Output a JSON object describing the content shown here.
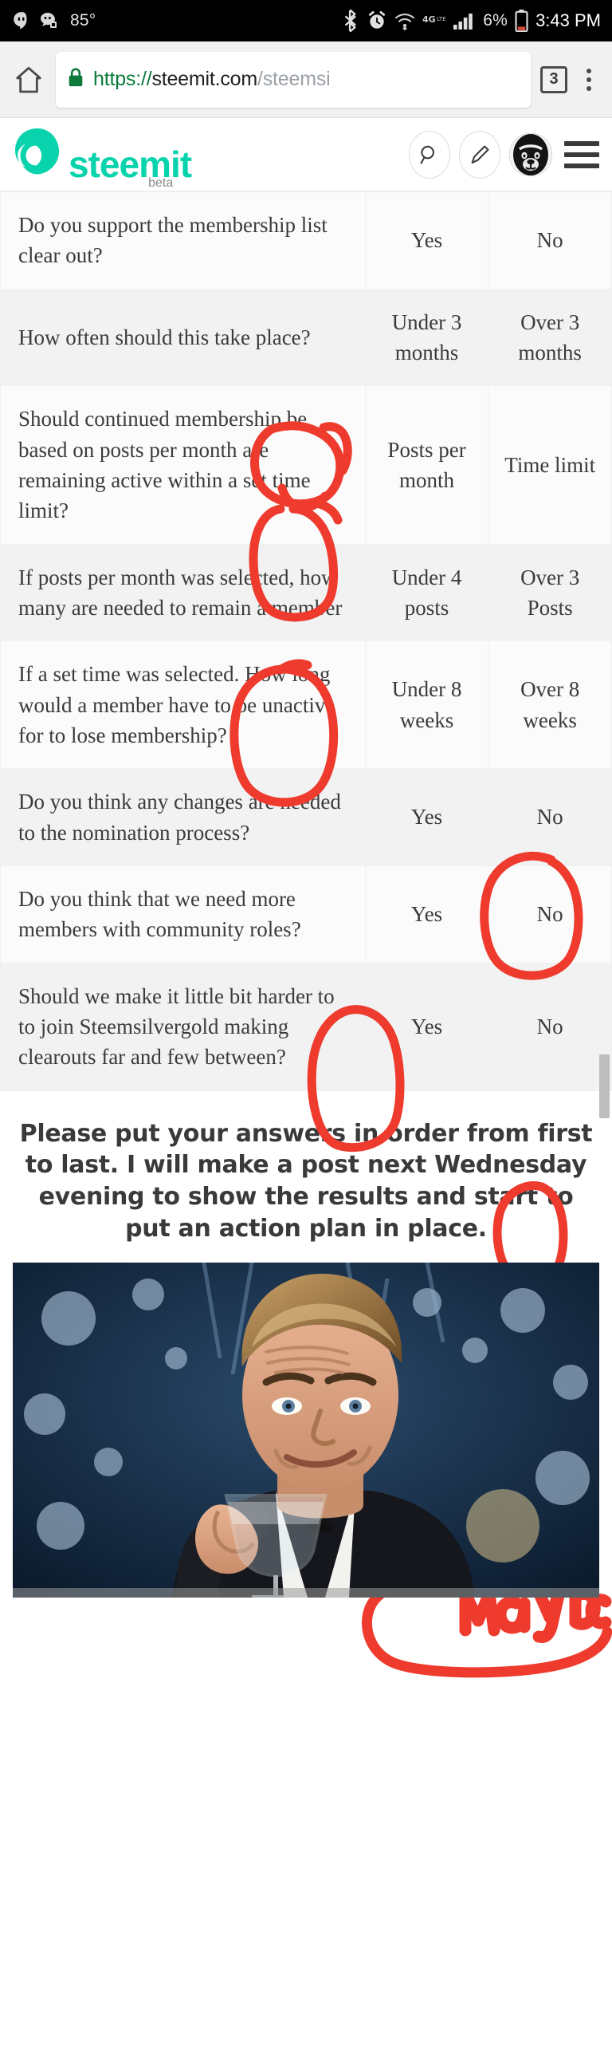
{
  "statusbar": {
    "left_icons": [
      "hangouts-icon",
      "messages-icon"
    ],
    "temperature": "85°",
    "right_icons": [
      "bluetooth-icon",
      "alarm-icon",
      "wifi-icon",
      "lte-icon",
      "signal-icon",
      "battery-icon"
    ],
    "network_label": "4G",
    "battery_percent": "6%",
    "time": "3:43 PM"
  },
  "browser": {
    "home_icon": "home-icon",
    "lock_icon": "lock-icon",
    "url_scheme": "https://",
    "url_host": "steemit.com",
    "url_path": "/steemsi",
    "tab_count": "3",
    "menu_icon": "kebab-menu-icon"
  },
  "site_header": {
    "brand": "steemit",
    "brand_tag": "beta",
    "brand_color": "#09d3ac",
    "search_icon": "search-icon",
    "compose_icon": "pencil-icon",
    "avatar": "user-avatar",
    "menu_icon": "hamburger-icon"
  },
  "survey": {
    "rows": [
      {
        "question": "Do you support the membership list clear out?",
        "option_a": "Yes",
        "option_b": "No",
        "circled": "a"
      },
      {
        "question": "How often should this take place?",
        "option_a": "Under 3 months",
        "option_b": "Over 3 months",
        "circled": "a"
      },
      {
        "question": "Should continued membership be based on posts per month are remaining active within a set time limit?",
        "option_a": "Posts per month",
        "option_b": "Time limit",
        "circled": "a"
      },
      {
        "question": "If posts per month was selected, how many are needed to remain a member",
        "option_a": "Under 4 posts",
        "option_b": "Over 3 Posts",
        "circled": "b"
      },
      {
        "question": "If a set time was selected. How long would a member have to be unactive for to lose membership?",
        "option_a": "Under 8 weeks",
        "option_b": "Over 8 weeks",
        "circled": "a"
      },
      {
        "question": "Do you think any changes are needed to the nomination process?",
        "option_a": "Yes",
        "option_b": "No",
        "circled": "b"
      },
      {
        "question": "Do you think that we need more members with community roles?",
        "option_a": "Yes",
        "option_b": "No",
        "circled": "a"
      },
      {
        "question": "Should we make it little bit harder to to join Steemsilvergold making clearouts far and few between?",
        "option_a": "Yes",
        "option_b": "No",
        "circled": "none"
      }
    ],
    "handwritten_note": "Maybe",
    "ink_color": "#ee3b2e"
  },
  "post": {
    "lead_paragraph": "Please put your answers in order from first to last. I will make a post next Wednesday evening to show the results and start to put an action plan in place.",
    "image_alt": "cheers-meme-image"
  }
}
